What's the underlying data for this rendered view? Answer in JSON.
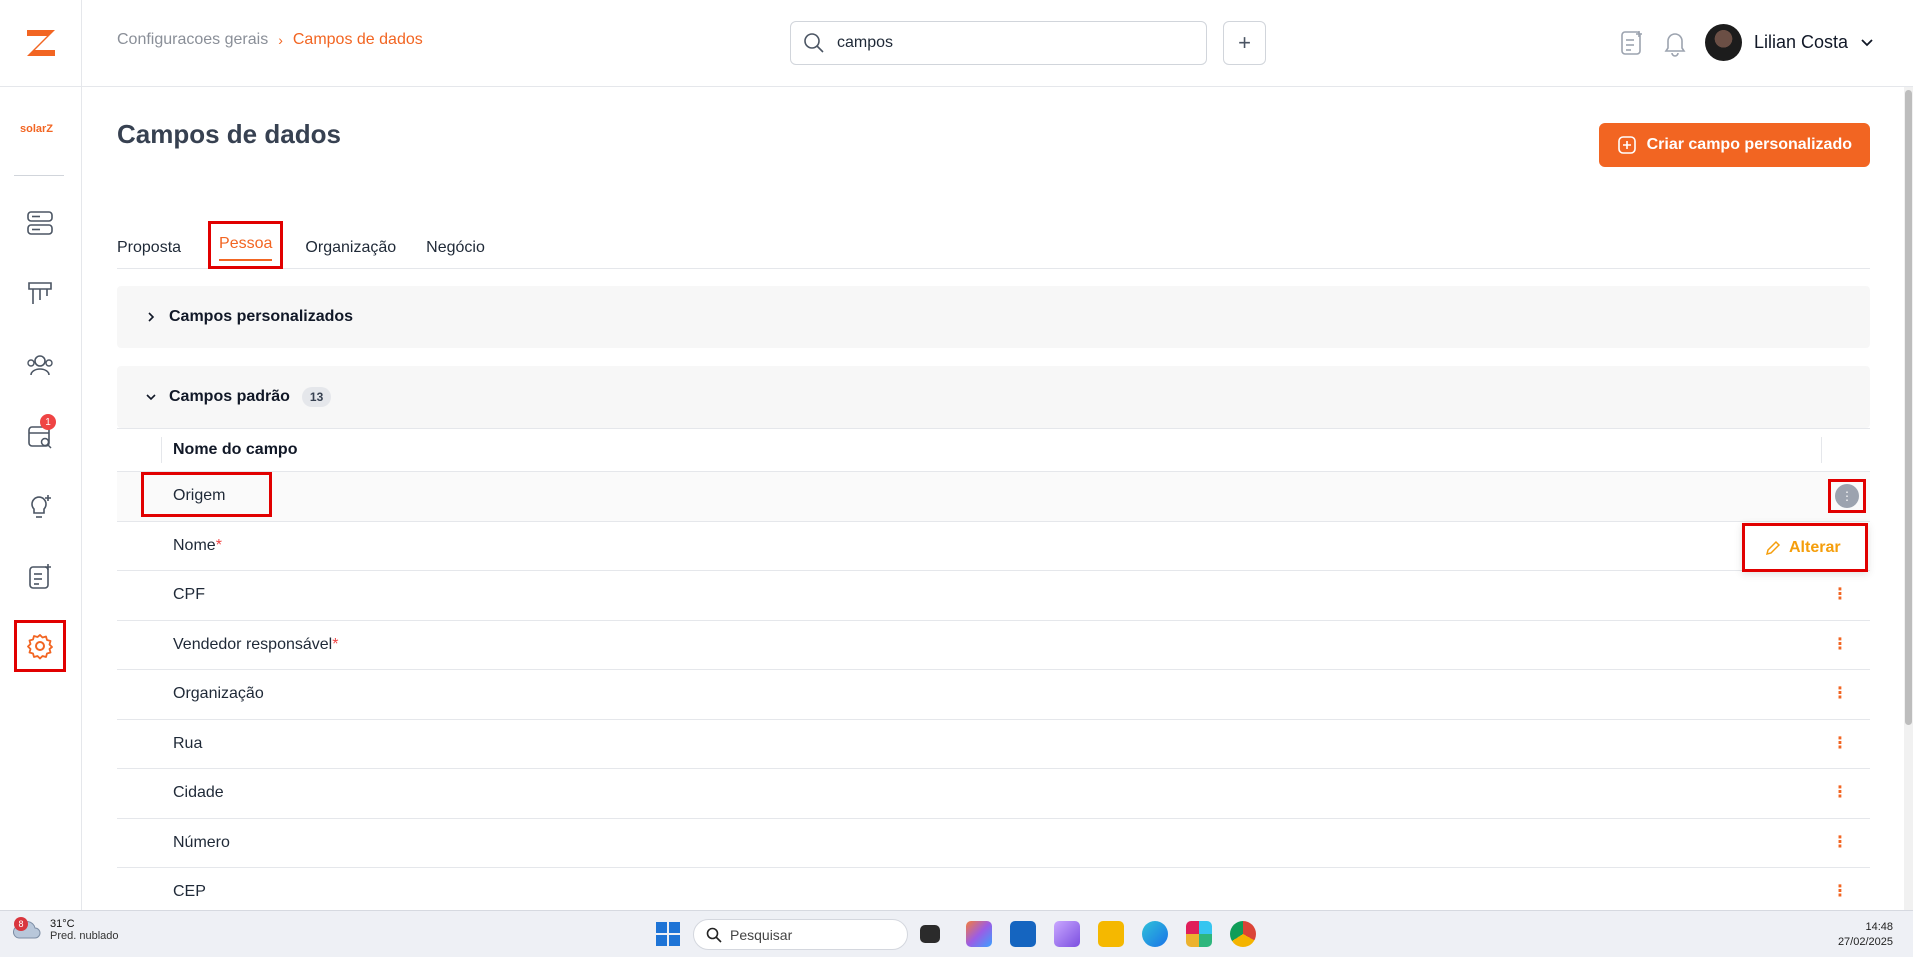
{
  "header": {
    "breadcrumb_root": "Configuracoes gerais",
    "breadcrumb_sep": "›",
    "breadcrumb_current": "Campos de dados",
    "search_value": "campos",
    "add_label": "+",
    "user_name": "Lilian Costa"
  },
  "sidebar": {
    "brand": "solarZ",
    "badge": "1"
  },
  "main": {
    "title": "Campos de dados",
    "create_button": "Criar campo personalizado",
    "tabs": [
      "Proposta",
      "Pessoa",
      "Organização",
      "Negócio"
    ],
    "active_tab": "Pessoa",
    "custom_section": "Campos personalizados",
    "standard_section": "Campos padrão",
    "standard_count": "13",
    "column_header": "Nome do campo",
    "rows": [
      {
        "name": "Origem",
        "required": ""
      },
      {
        "name": "Nome",
        "required": "*"
      },
      {
        "name": "CPF",
        "required": ""
      },
      {
        "name": "Vendedor responsável",
        "required": "*"
      },
      {
        "name": "Organização",
        "required": ""
      },
      {
        "name": "Rua",
        "required": ""
      },
      {
        "name": "Cidade",
        "required": ""
      },
      {
        "name": "Número",
        "required": ""
      },
      {
        "name": "CEP",
        "required": ""
      }
    ],
    "kebab": "⋮",
    "dropdown_item": "Alterar"
  },
  "taskbar": {
    "weather_badge": "8",
    "temp": "31°C",
    "weather": "Pred. nublado",
    "search": "Pesquisar",
    "time": "14:48",
    "date": "27/02/2025"
  },
  "colors": {
    "accent": "#f26522",
    "highlight": "#e10000",
    "required": "#ef4444",
    "dropdown_text": "#f59e0b"
  }
}
